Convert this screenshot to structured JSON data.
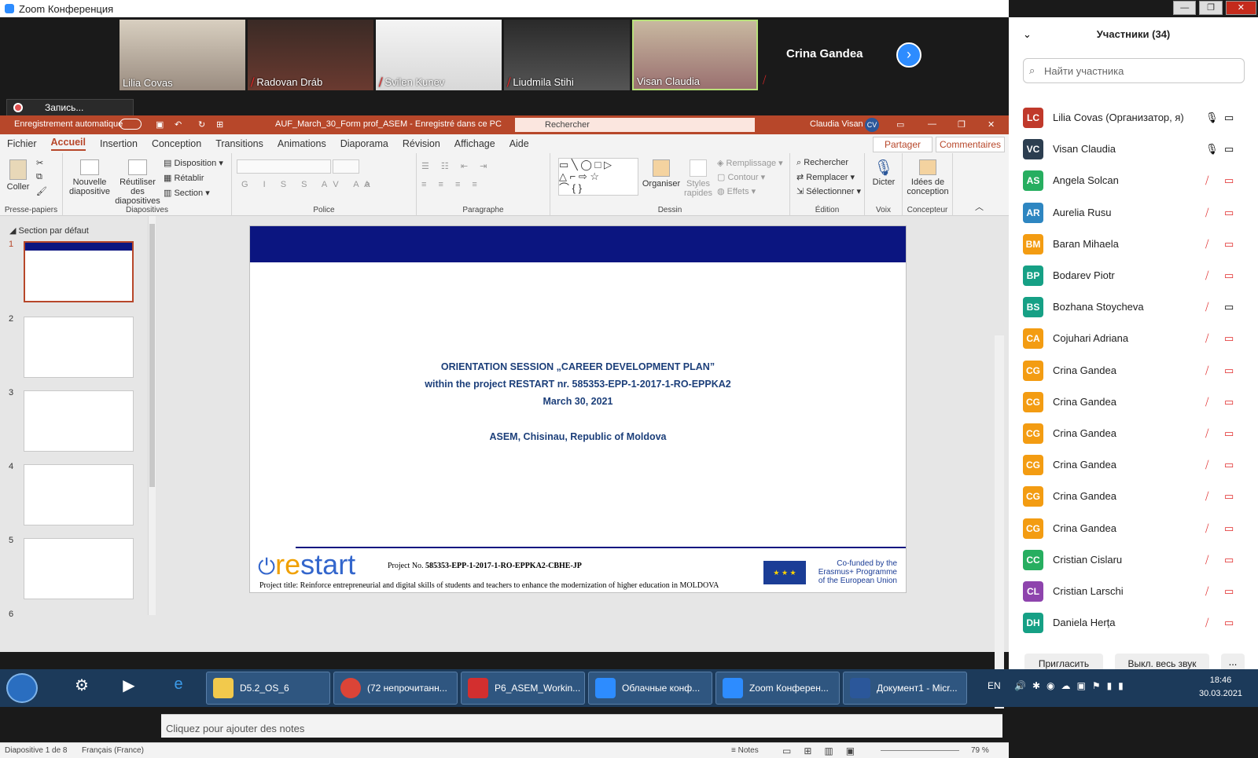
{
  "zoom": {
    "window_title": "Zoom Конференция",
    "recording_label": "Запись...",
    "pinned_name": "Crina Gandea",
    "video_tiles": [
      "Lilia Covas",
      "Radovan Dráb",
      "Svilen Kunev",
      "Liudmila Stihi",
      "Visan Claudia"
    ]
  },
  "ppt": {
    "autosave_label": "Enregistrement automatique",
    "file_title": "AUF_March_30_Form prof_ASEM  -  Enregistré dans ce PC",
    "search_placeholder": "Rechercher",
    "user_name": "Claudia Visan",
    "user_initials": "CV",
    "tabs": [
      "Fichier",
      "Accueil",
      "Insertion",
      "Conception",
      "Transitions",
      "Animations",
      "Diaporama",
      "Révision",
      "Affichage",
      "Aide"
    ],
    "share_label": "Partager",
    "comments_label": "Commentaires",
    "ribbon": {
      "paste": "Coller",
      "clipboard_group": "Presse-papiers",
      "new_slide": "Nouvelle diapositive",
      "reuse": "Réutiliser des diapositives",
      "layout": "Disposition",
      "reset": "Rétablir",
      "section": "Section",
      "slides_group": "Diapositives",
      "font_group": "Police",
      "paragraph_group": "Paragraphe",
      "arrange": "Organiser",
      "quick_styles": "Styles rapides",
      "fill": "Remplissage",
      "outline": "Contour",
      "effects": "Effets",
      "drawing_group": "Dessin",
      "find": "Rechercher",
      "replace": "Remplacer",
      "select": "Sélectionner",
      "editing_group": "Édition",
      "dictate": "Dicter",
      "voice_group": "Voix",
      "design_ideas": "Idées de conception",
      "designer_group": "Concepteur"
    },
    "section_label": "Section par défaut",
    "slide_numbers": [
      "1",
      "2",
      "3",
      "4",
      "5",
      "6"
    ],
    "slide": {
      "line1": "ORIENTATION SESSION „CAREER DEVELOPMENT PLAN”",
      "line2": "within the project RESTART nr. 585353-EPP-1-2017-1-RO-EPPKA2",
      "line3": "March 30, 2021",
      "line4": "ASEM, Chisinau, Republic of Moldova",
      "logo_re": "re",
      "logo_start": "start",
      "project_no_label": "Project No.",
      "project_no": "585353-EPP-1-2017-1-RO-EPPKA2-CBHE-JP",
      "project_title": "Project title: Reinforce entrepreneurial and digital skills of students and teachers to enhance the modernization of higher education in MOLDOVA",
      "cofunded": "Co-funded by the Erasmus+ Programme of the European Union"
    },
    "notes_placeholder": "Cliquez pour ajouter des notes",
    "status_slide": "Diapositive 1 de 8",
    "status_lang": "Français (France)",
    "status_notes": "Notes",
    "zoom_level": "79 %"
  },
  "participants": {
    "title": "Участники (34)",
    "search_placeholder": "Найти участника",
    "list": [
      {
        "initials": "LC",
        "name": "Lilia Covas (Организатор, я)",
        "color": "#c0392b"
      },
      {
        "initials": "VC",
        "name": "Visan Claudia",
        "color": "#2c3e50"
      },
      {
        "initials": "AS",
        "name": "Angela Solcan",
        "color": "#27ae60"
      },
      {
        "initials": "AR",
        "name": "Aurelia Rusu",
        "color": "#2e86c1"
      },
      {
        "initials": "BM",
        "name": "Baran Mihaela",
        "color": "#f39c12"
      },
      {
        "initials": "BP",
        "name": "Bodarev Piotr",
        "color": "#16a085"
      },
      {
        "initials": "BS",
        "name": "Bozhana Stoycheva",
        "color": "#16a085"
      },
      {
        "initials": "CA",
        "name": "Cojuhari Adriana",
        "color": "#f39c12"
      },
      {
        "initials": "CG",
        "name": "Crina Gandea",
        "color": "#f39c12"
      },
      {
        "initials": "CG",
        "name": "Crina Gandea",
        "color": "#f39c12"
      },
      {
        "initials": "CG",
        "name": "Crina Gandea",
        "color": "#f39c12"
      },
      {
        "initials": "CG",
        "name": "Crina Gandea",
        "color": "#f39c12"
      },
      {
        "initials": "CG",
        "name": "Crina Gandea",
        "color": "#f39c12"
      },
      {
        "initials": "CG",
        "name": "Crina Gandea",
        "color": "#f39c12"
      },
      {
        "initials": "CC",
        "name": "Cristian Cislaru",
        "color": "#27ae60"
      },
      {
        "initials": "CL",
        "name": "Cristian Larschi",
        "color": "#8e44ad"
      },
      {
        "initials": "DH",
        "name": "Daniela Herța",
        "color": "#16a085"
      }
    ],
    "invite_label": "Пригласить",
    "mute_all_label": "Выкл. весь звук",
    "more_label": "..."
  },
  "taskbar": {
    "items": [
      "D5.2_OS_6",
      "(72 непрочитанн...",
      "P6_ASEM_Workin...",
      "Облачные конф...",
      "Zoom Конферен...",
      "Документ1 - Micr..."
    ],
    "lang": "EN",
    "time": "18:46",
    "date": "30.03.2021"
  }
}
